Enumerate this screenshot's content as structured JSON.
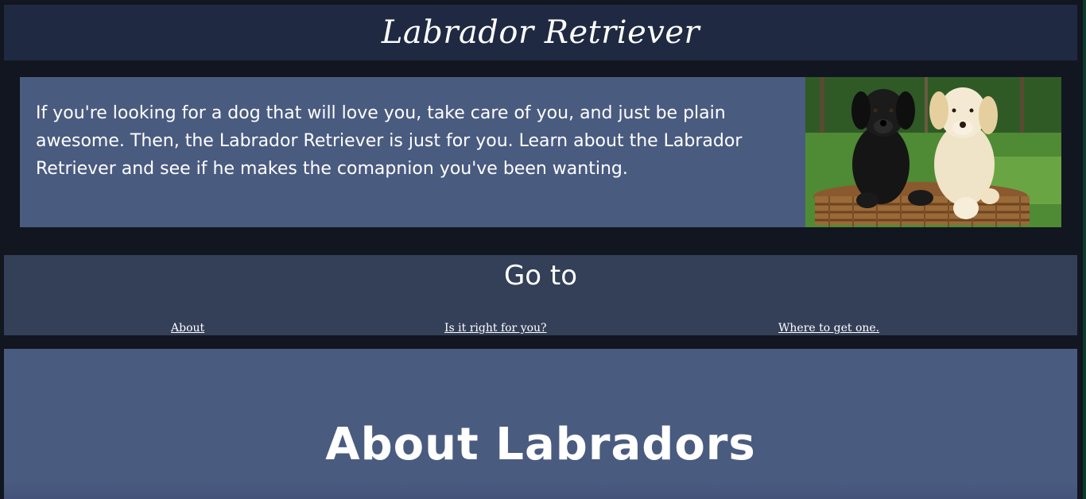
{
  "header": {
    "title": "Labrador Retriever"
  },
  "intro": {
    "text": "If you're looking for a dog that will love you, take care of you, and just be plain awesome. Then, the Labrador Retriever is just for you. Learn about the Labrador Retriever and see if he makes the comapnion you've been wanting.",
    "image_subject": "two-labrador-puppies-in-basket"
  },
  "nav": {
    "title": "Go to",
    "links": [
      {
        "label": "About"
      },
      {
        "label": "Is it right for you?"
      },
      {
        "label": "Where to get one."
      }
    ]
  },
  "about": {
    "title": "About Labradors"
  },
  "colors": {
    "page_background": "#121620",
    "header_background": "#1f2a42",
    "panel_background": "#4a5b80",
    "nav_background": "#343f58",
    "text": "#ffffff"
  }
}
